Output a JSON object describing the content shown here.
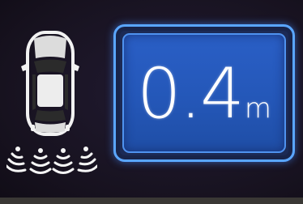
{
  "parking_sensor": {
    "distance_value": "0.4",
    "distance_unit": "m",
    "rear_sensor_zones": 4
  },
  "colors": {
    "panel_border": "#5aa6ff",
    "panel_fill": "#2457b8",
    "text": "#ffffff",
    "car_body": "#f2f2f2",
    "background": "#1a1526"
  }
}
